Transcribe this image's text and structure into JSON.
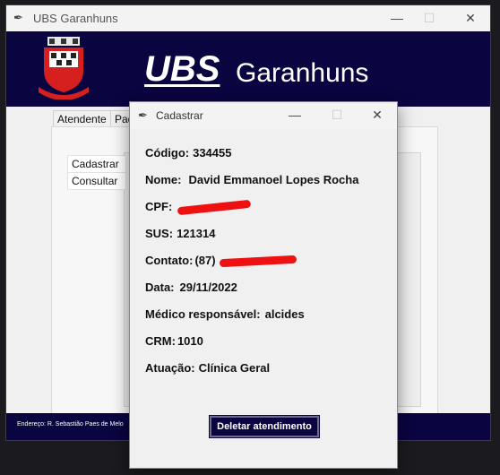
{
  "main_window": {
    "title": "UBS Garanhuns",
    "controls": {
      "minimize": "—",
      "maximize": "☐",
      "close": "✕"
    }
  },
  "header": {
    "brand_ubs": "UBS",
    "brand_city": "Garanhuns",
    "colors": {
      "background": "#0a0440",
      "text": "#ffffff"
    }
  },
  "tabs": [
    "Atendente",
    "Pac"
  ],
  "menu": {
    "items": [
      "Cadastrar",
      "Consultar"
    ]
  },
  "footer": {
    "address": "Endereço: R. Sebastião Paes de Melo"
  },
  "dialog": {
    "title": "Cadastrar",
    "controls": {
      "minimize": "—",
      "maximize": "☐",
      "close": "✕"
    },
    "fields": [
      {
        "label": "Código:",
        "value": "334455"
      },
      {
        "label": "Nome:",
        "value": "David Emmanoel Lopes Rocha"
      },
      {
        "label": "CPF:",
        "value": ""
      },
      {
        "label": "SUS:",
        "value": "121314"
      },
      {
        "label": "Contato:",
        "value": "(87)"
      },
      {
        "label": "Data:",
        "value": "29/11/2022"
      },
      {
        "label": "Médico responsável:",
        "value": "alcides"
      },
      {
        "label": "CRM:",
        "value": "1010"
      },
      {
        "label": "Atuação:",
        "value": "Clínica Geral"
      }
    ],
    "delete_button": "Deletar atendimento"
  }
}
